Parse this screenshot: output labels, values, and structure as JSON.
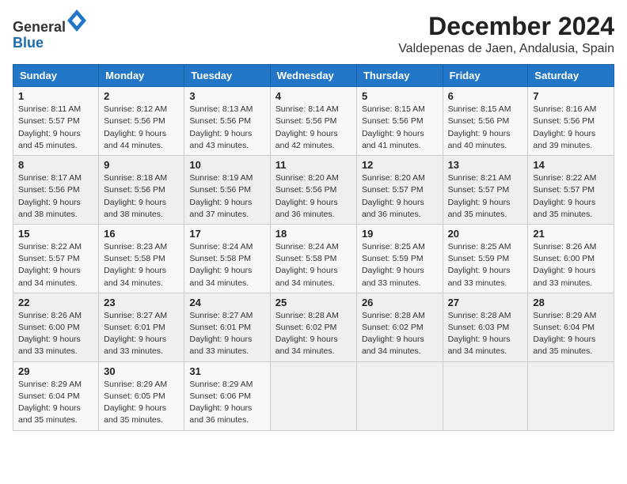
{
  "header": {
    "logo_general": "General",
    "logo_blue": "Blue",
    "main_title": "December 2024",
    "subtitle": "Valdepenas de Jaen, Andalusia, Spain"
  },
  "calendar": {
    "weekdays": [
      "Sunday",
      "Monday",
      "Tuesday",
      "Wednesday",
      "Thursday",
      "Friday",
      "Saturday"
    ],
    "weeks": [
      [
        {
          "day": "1",
          "sunrise": "Sunrise: 8:11 AM",
          "sunset": "Sunset: 5:57 PM",
          "daylight": "Daylight: 9 hours and 45 minutes."
        },
        {
          "day": "2",
          "sunrise": "Sunrise: 8:12 AM",
          "sunset": "Sunset: 5:56 PM",
          "daylight": "Daylight: 9 hours and 44 minutes."
        },
        {
          "day": "3",
          "sunrise": "Sunrise: 8:13 AM",
          "sunset": "Sunset: 5:56 PM",
          "daylight": "Daylight: 9 hours and 43 minutes."
        },
        {
          "day": "4",
          "sunrise": "Sunrise: 8:14 AM",
          "sunset": "Sunset: 5:56 PM",
          "daylight": "Daylight: 9 hours and 42 minutes."
        },
        {
          "day": "5",
          "sunrise": "Sunrise: 8:15 AM",
          "sunset": "Sunset: 5:56 PM",
          "daylight": "Daylight: 9 hours and 41 minutes."
        },
        {
          "day": "6",
          "sunrise": "Sunrise: 8:15 AM",
          "sunset": "Sunset: 5:56 PM",
          "daylight": "Daylight: 9 hours and 40 minutes."
        },
        {
          "day": "7",
          "sunrise": "Sunrise: 8:16 AM",
          "sunset": "Sunset: 5:56 PM",
          "daylight": "Daylight: 9 hours and 39 minutes."
        }
      ],
      [
        {
          "day": "8",
          "sunrise": "Sunrise: 8:17 AM",
          "sunset": "Sunset: 5:56 PM",
          "daylight": "Daylight: 9 hours and 38 minutes."
        },
        {
          "day": "9",
          "sunrise": "Sunrise: 8:18 AM",
          "sunset": "Sunset: 5:56 PM",
          "daylight": "Daylight: 9 hours and 38 minutes."
        },
        {
          "day": "10",
          "sunrise": "Sunrise: 8:19 AM",
          "sunset": "Sunset: 5:56 PM",
          "daylight": "Daylight: 9 hours and 37 minutes."
        },
        {
          "day": "11",
          "sunrise": "Sunrise: 8:20 AM",
          "sunset": "Sunset: 5:56 PM",
          "daylight": "Daylight: 9 hours and 36 minutes."
        },
        {
          "day": "12",
          "sunrise": "Sunrise: 8:20 AM",
          "sunset": "Sunset: 5:57 PM",
          "daylight": "Daylight: 9 hours and 36 minutes."
        },
        {
          "day": "13",
          "sunrise": "Sunrise: 8:21 AM",
          "sunset": "Sunset: 5:57 PM",
          "daylight": "Daylight: 9 hours and 35 minutes."
        },
        {
          "day": "14",
          "sunrise": "Sunrise: 8:22 AM",
          "sunset": "Sunset: 5:57 PM",
          "daylight": "Daylight: 9 hours and 35 minutes."
        }
      ],
      [
        {
          "day": "15",
          "sunrise": "Sunrise: 8:22 AM",
          "sunset": "Sunset: 5:57 PM",
          "daylight": "Daylight: 9 hours and 34 minutes."
        },
        {
          "day": "16",
          "sunrise": "Sunrise: 8:23 AM",
          "sunset": "Sunset: 5:58 PM",
          "daylight": "Daylight: 9 hours and 34 minutes."
        },
        {
          "day": "17",
          "sunrise": "Sunrise: 8:24 AM",
          "sunset": "Sunset: 5:58 PM",
          "daylight": "Daylight: 9 hours and 34 minutes."
        },
        {
          "day": "18",
          "sunrise": "Sunrise: 8:24 AM",
          "sunset": "Sunset: 5:58 PM",
          "daylight": "Daylight: 9 hours and 34 minutes."
        },
        {
          "day": "19",
          "sunrise": "Sunrise: 8:25 AM",
          "sunset": "Sunset: 5:59 PM",
          "daylight": "Daylight: 9 hours and 33 minutes."
        },
        {
          "day": "20",
          "sunrise": "Sunrise: 8:25 AM",
          "sunset": "Sunset: 5:59 PM",
          "daylight": "Daylight: 9 hours and 33 minutes."
        },
        {
          "day": "21",
          "sunrise": "Sunrise: 8:26 AM",
          "sunset": "Sunset: 6:00 PM",
          "daylight": "Daylight: 9 hours and 33 minutes."
        }
      ],
      [
        {
          "day": "22",
          "sunrise": "Sunrise: 8:26 AM",
          "sunset": "Sunset: 6:00 PM",
          "daylight": "Daylight: 9 hours and 33 minutes."
        },
        {
          "day": "23",
          "sunrise": "Sunrise: 8:27 AM",
          "sunset": "Sunset: 6:01 PM",
          "daylight": "Daylight: 9 hours and 33 minutes."
        },
        {
          "day": "24",
          "sunrise": "Sunrise: 8:27 AM",
          "sunset": "Sunset: 6:01 PM",
          "daylight": "Daylight: 9 hours and 33 minutes."
        },
        {
          "day": "25",
          "sunrise": "Sunrise: 8:28 AM",
          "sunset": "Sunset: 6:02 PM",
          "daylight": "Daylight: 9 hours and 34 minutes."
        },
        {
          "day": "26",
          "sunrise": "Sunrise: 8:28 AM",
          "sunset": "Sunset: 6:02 PM",
          "daylight": "Daylight: 9 hours and 34 minutes."
        },
        {
          "day": "27",
          "sunrise": "Sunrise: 8:28 AM",
          "sunset": "Sunset: 6:03 PM",
          "daylight": "Daylight: 9 hours and 34 minutes."
        },
        {
          "day": "28",
          "sunrise": "Sunrise: 8:29 AM",
          "sunset": "Sunset: 6:04 PM",
          "daylight": "Daylight: 9 hours and 35 minutes."
        }
      ],
      [
        {
          "day": "29",
          "sunrise": "Sunrise: 8:29 AM",
          "sunset": "Sunset: 6:04 PM",
          "daylight": "Daylight: 9 hours and 35 minutes."
        },
        {
          "day": "30",
          "sunrise": "Sunrise: 8:29 AM",
          "sunset": "Sunset: 6:05 PM",
          "daylight": "Daylight: 9 hours and 35 minutes."
        },
        {
          "day": "31",
          "sunrise": "Sunrise: 8:29 AM",
          "sunset": "Sunset: 6:06 PM",
          "daylight": "Daylight: 9 hours and 36 minutes."
        },
        null,
        null,
        null,
        null
      ]
    ]
  }
}
